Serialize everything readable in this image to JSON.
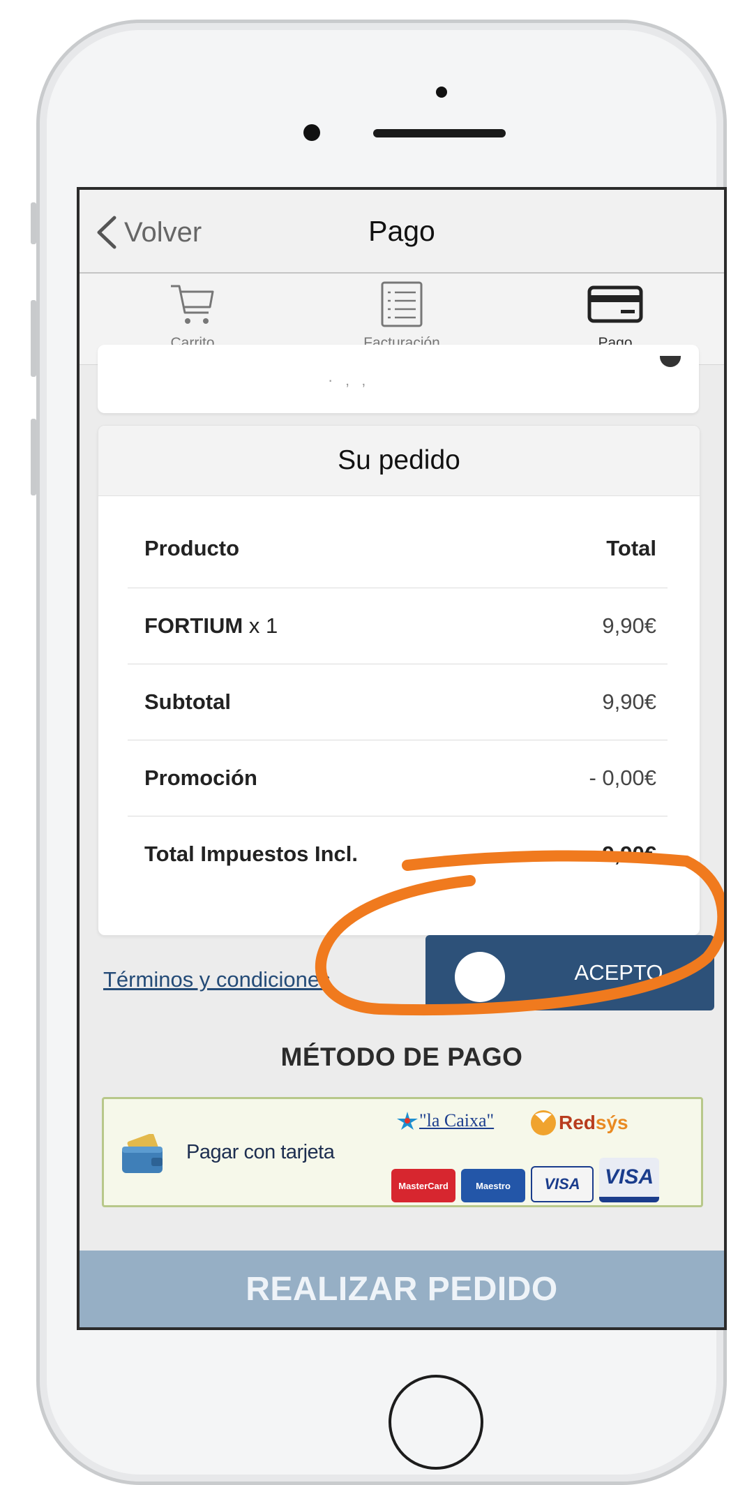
{
  "nav": {
    "back_label": "Volver",
    "title": "Pago"
  },
  "steps": [
    {
      "label": "Carrito",
      "icon": "cart-icon"
    },
    {
      "label": "Facturación",
      "icon": "list-icon"
    },
    {
      "label": "Pago",
      "icon": "credit-card-icon",
      "active": true
    }
  ],
  "order": {
    "title": "Su pedido",
    "header": {
      "label": "Producto",
      "value": "Total"
    },
    "rows": [
      {
        "label": "FORTIUM",
        "qty": "x 1",
        "value": "9,90€"
      },
      {
        "label": "Subtotal",
        "value": "9,90€"
      },
      {
        "label": "Promoción",
        "value": "- 0,00€"
      },
      {
        "label": "Total Impuestos Incl.",
        "value": "9,90€"
      }
    ]
  },
  "terms": {
    "link_label": "Términos y condiciones",
    "toggle_label": "ACEPTO"
  },
  "payment": {
    "section_title": "MÉTODO DE PAGO",
    "option_label": "Pagar con tarjeta",
    "logos": {
      "lacaixa": "\"la Caixa\"",
      "redsys_red": "Red",
      "redsys_sys": "sýs",
      "mastercard": "MasterCard",
      "maestro": "Maestro",
      "visa_electron": "VISA",
      "visa": "VISA"
    }
  },
  "cta": {
    "label": "REALIZAR PEDIDO"
  },
  "colors": {
    "accent": "#2d5179",
    "cta_background": "#96afc5",
    "annotation": "#f07a1e",
    "link": "#244b77"
  }
}
